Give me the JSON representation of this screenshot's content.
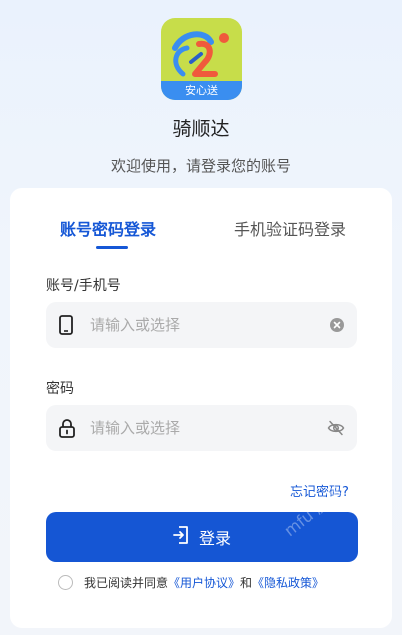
{
  "app": {
    "logo_text": "安心送",
    "name": "骑顺达",
    "welcome": "欢迎使用，请登录您的账号"
  },
  "tabs": [
    {
      "label": "账号密码登录",
      "active": true
    },
    {
      "label": "手机验证码登录",
      "active": false
    }
  ],
  "account": {
    "label": "账号/手机号",
    "placeholder": "请输入或选择",
    "value": ""
  },
  "password": {
    "label": "密码",
    "placeholder": "请输入或选择",
    "value": ""
  },
  "forgot_label": "忘记密码?",
  "login_label": "登录",
  "agreement": {
    "checked": false,
    "prefix": "我已阅读并同意",
    "user_agreement": "《用户协议》",
    "and": "和",
    "privacy_policy": "《隐私政策》"
  },
  "watermark": "mfu 魔趣",
  "colors": {
    "accent": "#1557d6",
    "logo_bg": "#c7dd4a",
    "logo_band": "#3a8ef0"
  }
}
